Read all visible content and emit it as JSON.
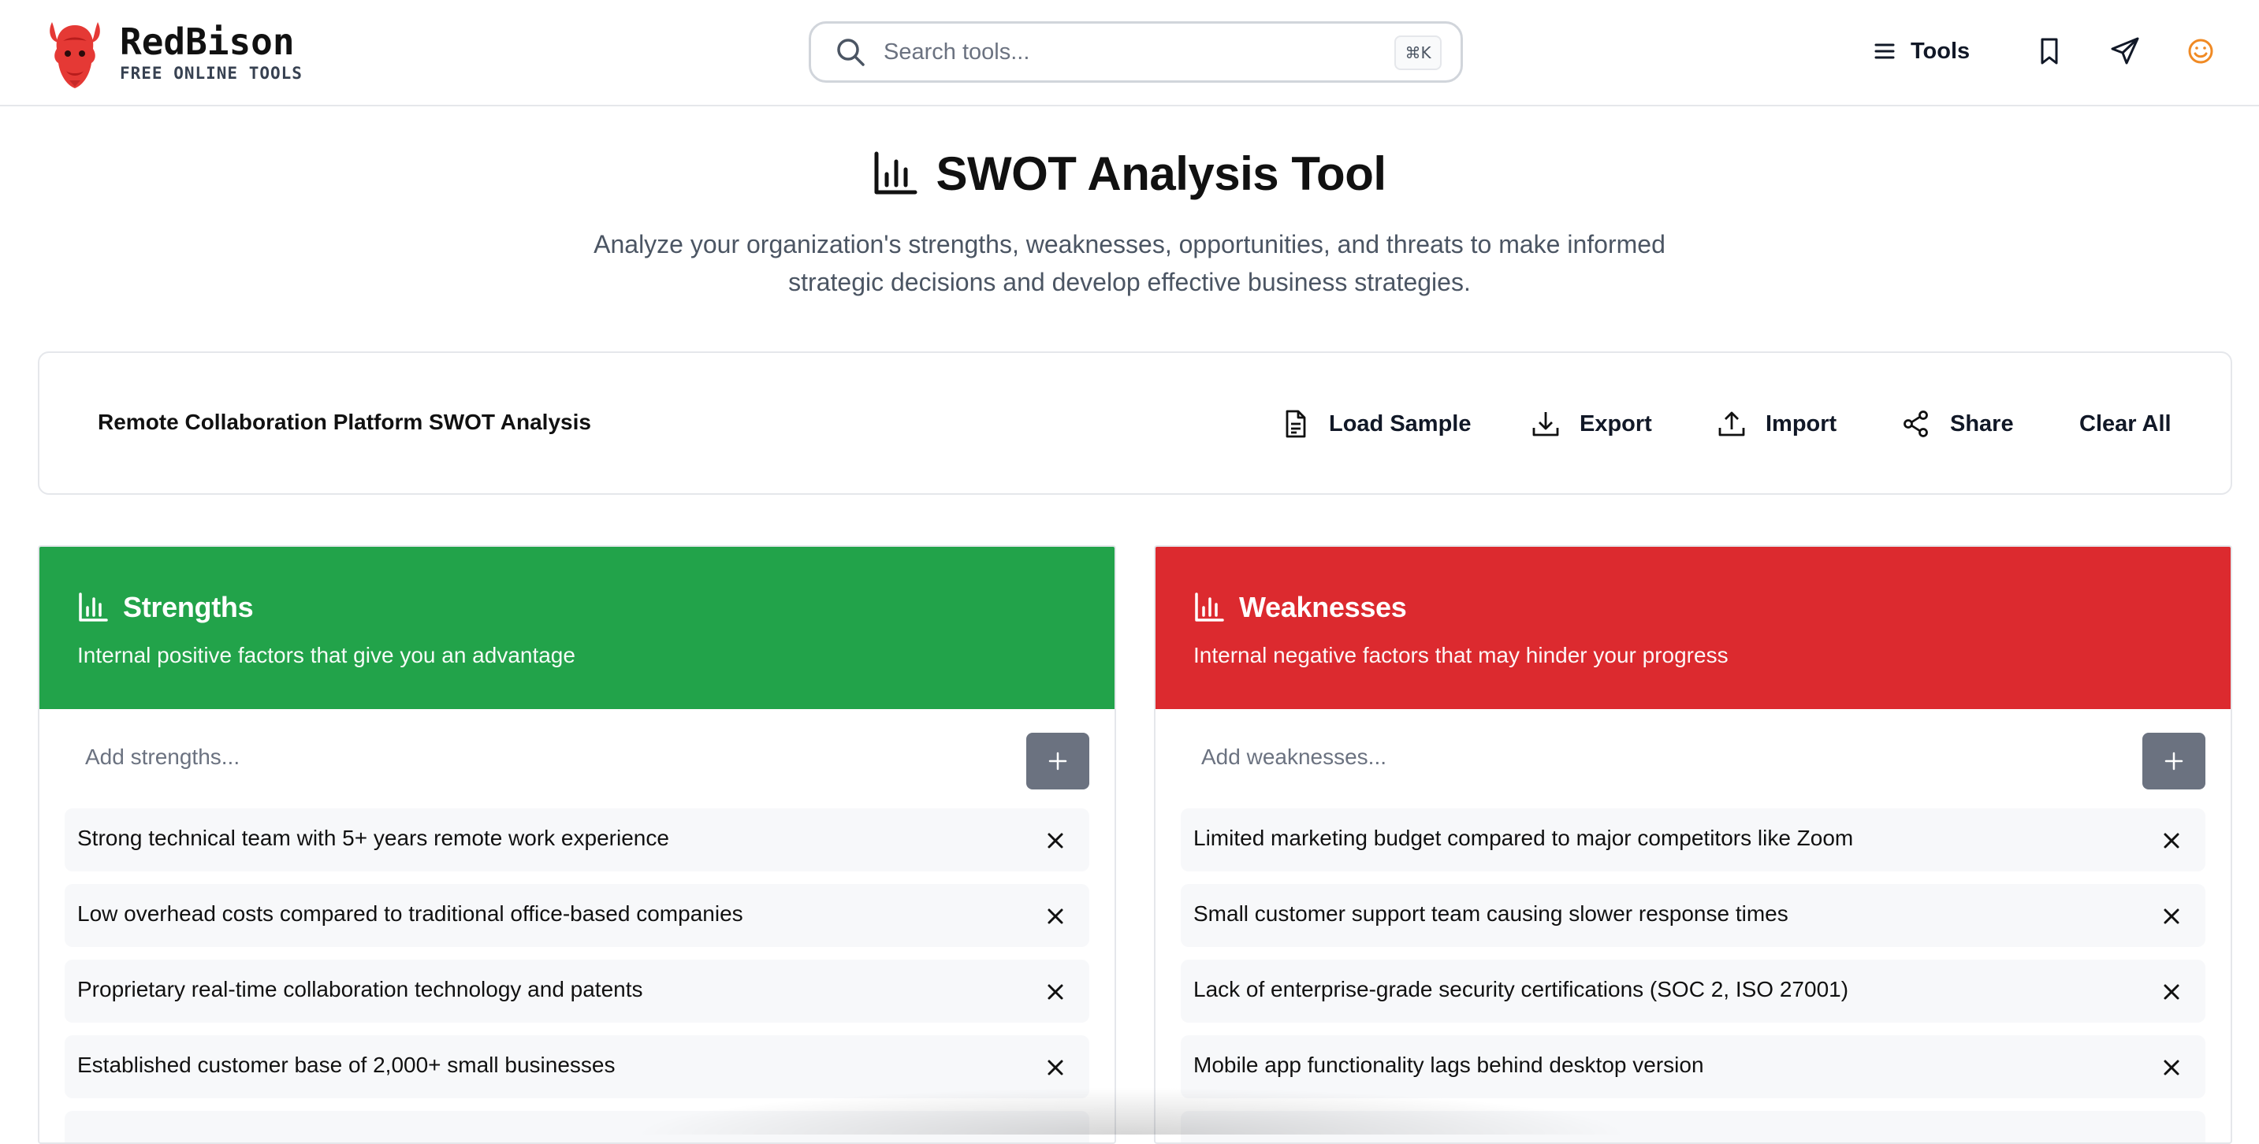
{
  "brand": {
    "name": "RedBison",
    "tagline": "FREE ONLINE TOOLS",
    "accent": "#e53935"
  },
  "search": {
    "placeholder": "Search tools...",
    "shortcut": "⌘K"
  },
  "nav": {
    "tools_label": "Tools",
    "icons": [
      "menu-icon",
      "bookmark-icon",
      "send-icon",
      "smiley-icon"
    ]
  },
  "hero": {
    "title": "SWOT Analysis Tool",
    "subtitle": "Analyze your organization's strengths, weaknesses, opportunities, and threats to make informed strategic decisions and develop effective business strategies."
  },
  "toolbar": {
    "analysis_title": "Remote Collaboration Platform SWOT Analysis",
    "load_sample": "Load Sample",
    "export": "Export",
    "import": "Import",
    "share": "Share",
    "clear_all": "Clear All"
  },
  "panels": {
    "strengths": {
      "title": "Strengths",
      "description": "Internal positive factors that give you an advantage",
      "placeholder": "Add strengths...",
      "color": "#22a34a",
      "items": [
        "Strong technical team with 5+ years remote work experience",
        "Low overhead costs compared to traditional office-based companies",
        "Proprietary real-time collaboration technology and patents",
        "Established customer base of 2,000+ small businesses"
      ]
    },
    "weaknesses": {
      "title": "Weaknesses",
      "description": "Internal negative factors that may hinder your progress",
      "placeholder": "Add weaknesses...",
      "color": "#dc2a2f",
      "items": [
        "Limited marketing budget compared to major competitors like Zoom",
        "Small customer support team causing slower response times",
        "Lack of enterprise-grade security certifications (SOC 2, ISO 27001)",
        "Mobile app functionality lags behind desktop version"
      ]
    }
  }
}
